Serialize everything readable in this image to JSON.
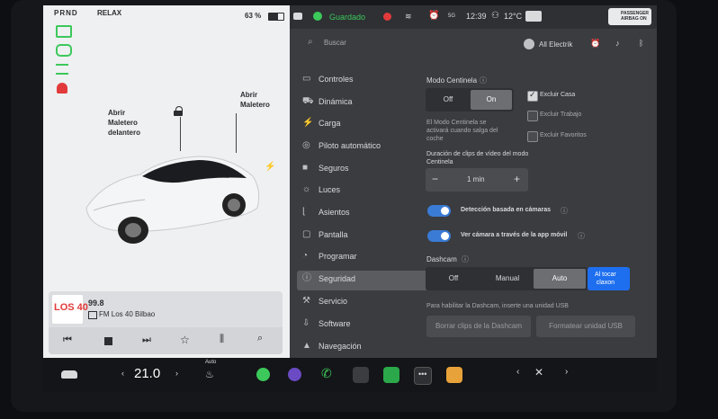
{
  "left_panel": {
    "gear": "PRND",
    "mode": "RELAX",
    "battery": "63 %",
    "trunk_label": "Abrir\nMaletero",
    "frunk_label": "Abrir\nMaletero\ndelantero"
  },
  "status_bar": {
    "saved_label": "Guardado",
    "time": "12:39",
    "temperature": "12°C",
    "airbag": "PASSENGER\nAIRBAG ON"
  },
  "header": {
    "search_placeholder": "Buscar",
    "user_name": "All Electrik"
  },
  "sidebar": {
    "items": [
      {
        "label": "Controles",
        "icon": "toggle-icon"
      },
      {
        "label": "Dinámica",
        "icon": "car-icon"
      },
      {
        "label": "Carga",
        "icon": "bolt-icon"
      },
      {
        "label": "Piloto automático",
        "icon": "steering-icon"
      },
      {
        "label": "Seguros",
        "icon": "lock-icon"
      },
      {
        "label": "Luces",
        "icon": "sun-icon"
      },
      {
        "label": "Asientos",
        "icon": "seat-icon"
      },
      {
        "label": "Pantalla",
        "icon": "screen-icon"
      },
      {
        "label": "Programar",
        "icon": "clock-icon"
      },
      {
        "label": "Seguridad",
        "icon": "info-icon"
      },
      {
        "label": "Servicio",
        "icon": "wrench-icon"
      },
      {
        "label": "Software",
        "icon": "download-icon"
      },
      {
        "label": "Navegación",
        "icon": "nav-icon"
      }
    ]
  },
  "sentry": {
    "title": "Modo Centinela",
    "off": "Off",
    "on": "On",
    "description": "El Modo Centinela se activará cuando salga del coche",
    "exclude_home": "Excluir Casa",
    "exclude_work": "Excluir Trabajo",
    "exclude_favorites": "Excluir Favoritos",
    "clip_duration_label": "Duración de clips de vídeo del modo Centinela",
    "clip_duration_value": "1 min",
    "camera_detection": "Detección basada en cámaras",
    "view_camera_app": "Ver cámara a través de la app móvil"
  },
  "dashcam": {
    "title": "Dashcam",
    "off": "Off",
    "manual": "Manual",
    "auto": "Auto",
    "honk": "Al tocar\nclaxon",
    "usb_note": "Para habilitar la Dashcam, inserte una unidad USB",
    "delete_clips": "Borrar clips de la Dashcam",
    "format_usb": "Formatear unidad USB"
  },
  "media": {
    "frequency": "99.8",
    "station": "FM Los 40 Bilbao",
    "logo": "LOS 40"
  },
  "dock": {
    "temperature": "21.0",
    "auto_label": "Auto"
  },
  "colors": {
    "accent_blue": "#3a7bd5",
    "honk_blue": "#1e6ff0",
    "green": "#3cc85a",
    "red": "#e23a3a"
  }
}
